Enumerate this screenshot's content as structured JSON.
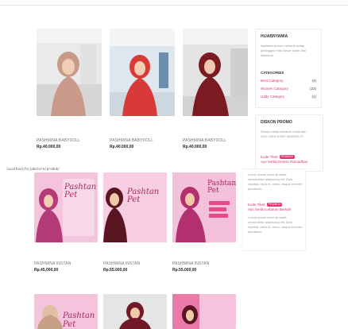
{
  "status_url": "localhost/hijabstore/produk/",
  "products": [
    {
      "name": "PASHMINA BABYDOLL",
      "price": "Rp.40.000,00",
      "image": "woman-beige-hijab-photo"
    },
    {
      "name": "PASHMINA BABYDOLL",
      "price": "Rp.40.000,00",
      "image": "woman-red-hijab-mall-photo"
    },
    {
      "name": "PASHMINA BABYDOLL",
      "price": "Rp.40.000,00",
      "image": "woman-maroon-hijab-photo"
    },
    {
      "name": "PASHMINA INSTAN",
      "price": "Rp.45.000,00",
      "image": "pashtan-pet-pink-promo",
      "promo_text": "Pashtan Pet"
    },
    {
      "name": "PASHMINA INSTAN",
      "price": "Rp.55.000,00",
      "image": "pashtan-pet-pink-promo",
      "promo_text": "Pashtan Pet"
    },
    {
      "name": "PASHMINA INSTAN",
      "price": "Rp.55.000,00",
      "image": "pashtan-pet-pink-promo",
      "promo_text": "Pashtan Pet"
    },
    {
      "name": "",
      "price": "",
      "image": "pashtan-pet-pink-promo",
      "promo_text": "Pashtan Pet"
    },
    {
      "name": "",
      "price": "",
      "image": "woman-maroon-hijab-photo"
    },
    {
      "name": "",
      "price": "",
      "image": "pashtan-pet-pink-promo"
    }
  ],
  "sidebar": {
    "about": {
      "title": "HIJABNYAMIA",
      "text": "Nantikan promo menarik setiap pelanggan Hari Besar Islam dan Nasional",
      "categories_title": "CATEGORIES",
      "categories": [
        {
          "label": "Best Category",
          "count": "(4)"
        },
        {
          "label": "Women Category",
          "count": "(23)"
        },
        {
          "label": "Uddy Category",
          "count": "(1)"
        }
      ]
    },
    "promo": {
      "title": "DISKON PROMO",
      "text": "Diskon besar-besaran mulai dari 10%-100% DONT MISSED IT!",
      "items": [
        {
          "code": "Kode Tiket:",
          "badge": "PROMO1",
          "headline": "Ayo Serbu Diskon Ramadhan",
          "desc": "Lorem ipsum dolor sit amet, consectetur adipiscing elit. Duis repellat, dicta et, nemo. Itaque eveniet architecto."
        },
        {
          "code": "Kode Tiket:",
          "badge": "PROMO2",
          "headline": "Ayo Serbu Lebaran Berkah",
          "desc": "Lorem ipsum dolor sit amet, consectetur adipiscing elit. Duis repellat, dicta et, nemo. Itaque eveniet architecto."
        }
      ]
    }
  }
}
